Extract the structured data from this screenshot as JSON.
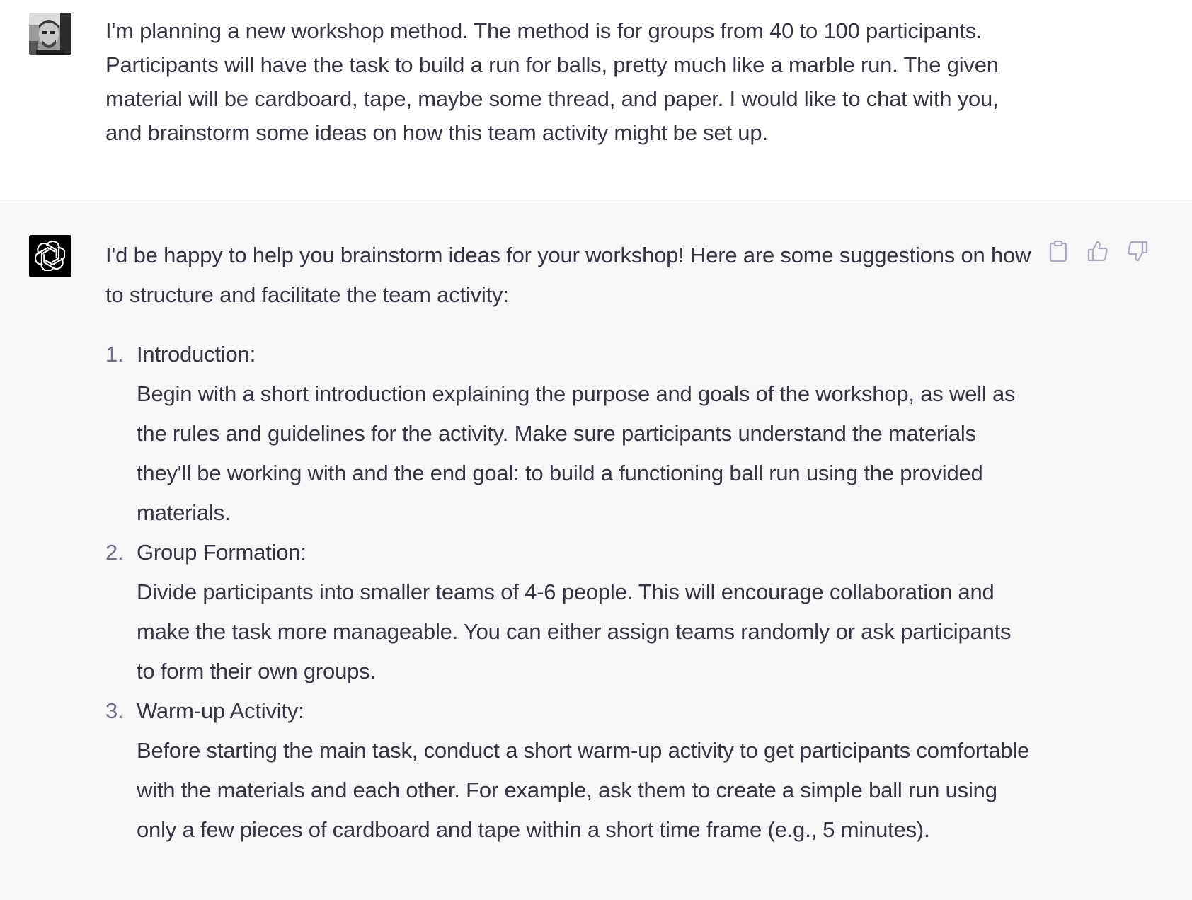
{
  "user_message": {
    "text": "I'm planning a new workshop method. The method is for groups from 40 to 100 participants. Participants will have the task to build a run for balls, pretty much like a marble run. The given material will be cardboard, tape, maybe some thread, and paper. I would like to chat with you, and brainstorm some ideas on how this team activity might be set up."
  },
  "assistant_message": {
    "intro": "I'd be happy to help you brainstorm ideas for your workshop! Here are some suggestions on how to structure and facilitate the team activity:",
    "steps": [
      {
        "number": "1.",
        "title": "Introduction:",
        "body": "Begin with a short introduction explaining the purpose and goals of the workshop, as well as the rules and guidelines for the activity. Make sure participants understand the materials they'll be working with and the end goal: to build a functioning ball run using the provided materials."
      },
      {
        "number": "2.",
        "title": "Group Formation:",
        "body": "Divide participants into smaller teams of 4-6 people. This will encourage collaboration and make the task more manageable. You can either assign teams randomly or ask participants to form their own groups."
      },
      {
        "number": "3.",
        "title": "Warm-up Activity:",
        "body": "Before starting the main task, conduct a short warm-up activity to get participants comfortable with the materials and each other. For example, ask them to create a simple ball run using only a few pieces of cardboard and tape within a short time frame (e.g., 5 minutes)."
      }
    ]
  },
  "icons": {
    "user_avatar": "user-avatar-photo",
    "assistant_avatar": "openai-logo-icon",
    "copy": "clipboard-icon",
    "like": "thumbs-up-icon",
    "dislike": "thumbs-down-icon"
  },
  "colors": {
    "user_bg": "#ffffff",
    "assistant_bg": "#f7f7f8",
    "text": "#343541",
    "list_number": "#6e6e80",
    "icon": "#acacbe"
  }
}
